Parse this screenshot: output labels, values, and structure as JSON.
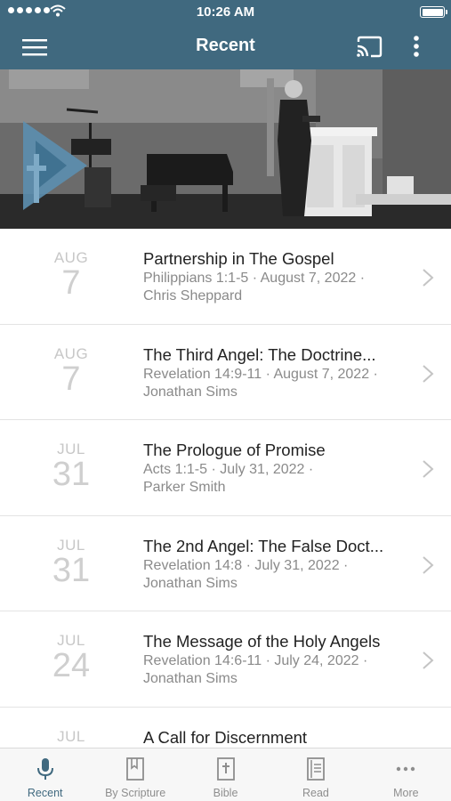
{
  "status_bar": {
    "time": "10:26 AM"
  },
  "nav": {
    "title": "Recent",
    "menu_icon": "hamburger-menu-icon",
    "cast_icon": "cast-icon",
    "more_icon": "vertical-ellipsis-icon"
  },
  "colors": {
    "accent": "#40697f",
    "date_gray": "#c7c7c7",
    "meta_gray": "#8a8a8a"
  },
  "sermons": [
    {
      "month": "AUG",
      "day": "7",
      "title": "Partnership in The Gospel",
      "meta": "Philippians 1:1-5 · August 7, 2022 ·",
      "speaker": "Chris Sheppard"
    },
    {
      "month": "AUG",
      "day": "7",
      "title": "The Third Angel: The Doctrine...",
      "meta": "Revelation 14:9-11 · August 7, 2022 ·",
      "speaker": "Jonathan Sims"
    },
    {
      "month": "JUL",
      "day": "31",
      "title": "The Prologue of Promise",
      "meta": "Acts 1:1-5 · July 31, 2022 ·",
      "speaker": "Parker Smith"
    },
    {
      "month": "JUL",
      "day": "31",
      "title": "The 2nd Angel: The False Doct...",
      "meta": "Revelation 14:8 · July 31, 2022 ·",
      "speaker": "Jonathan Sims"
    },
    {
      "month": "JUL",
      "day": "24",
      "title": "The Message of the Holy Angels",
      "meta": "Revelation 14:6-11 · July 24, 2022 ·",
      "speaker": "Jonathan Sims"
    },
    {
      "month": "JUL",
      "day": "",
      "title": "A Call for Discernment",
      "meta": "",
      "speaker": ""
    }
  ],
  "tabs": [
    {
      "label": "Recent",
      "icon": "microphone-icon",
      "active": true
    },
    {
      "label": "By Scripture",
      "icon": "bookmark-icon",
      "active": false
    },
    {
      "label": "Bible",
      "icon": "bible-icon",
      "active": false
    },
    {
      "label": "Read",
      "icon": "book-open-icon",
      "active": false
    },
    {
      "label": "More",
      "icon": "more-dots-icon",
      "active": false
    }
  ]
}
